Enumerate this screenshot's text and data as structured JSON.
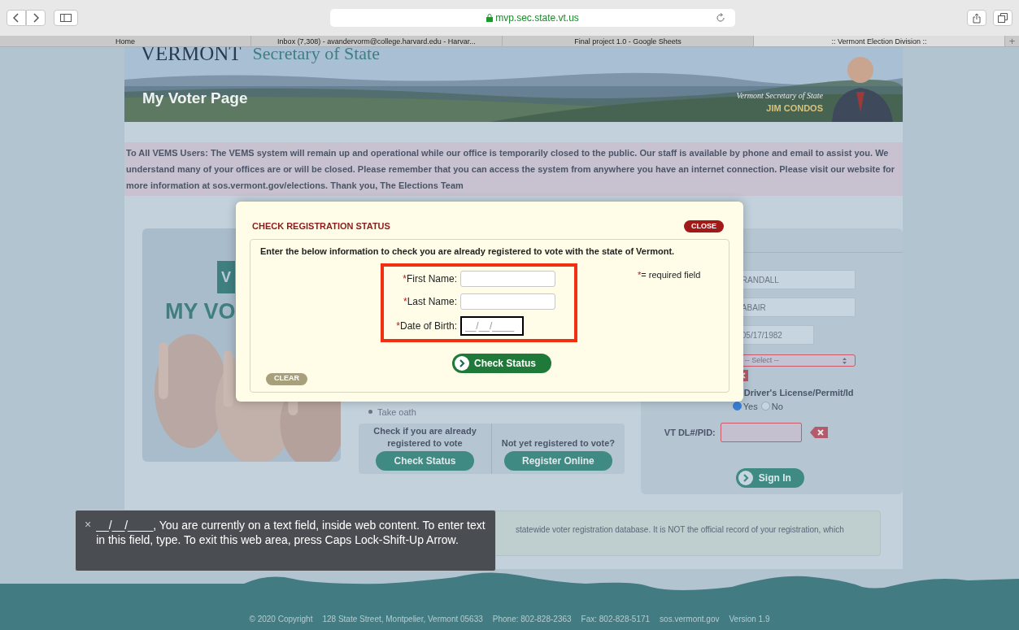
{
  "browser": {
    "url": "mvp.sec.state.vt.us",
    "tabs": [
      {
        "label": "Home",
        "selected": false
      },
      {
        "label": "Inbox (7,308) - avandervorm@college.harvard.edu - Harvar...",
        "selected": false
      },
      {
        "label": "Final project 1.0 - Google Sheets",
        "selected": false
      },
      {
        "label": ":: Vermont Election Division ::",
        "selected": true
      }
    ],
    "new_tab": "+"
  },
  "banner": {
    "state": "VERMONT",
    "office": "Secretary of State",
    "page_title": "My Voter Page",
    "official_title": "Vermont Secretary of State",
    "official_name": "JIM CONDOS"
  },
  "notice": "To All VEMS Users: The VEMS system will remain up and operational while our office is temporarily closed to the public. Our staff is available by phone and email to assist you. We understand many of your offices are or will be closed. Please remember that you can access the system from anywhere you have an internet connection. Please visit our website for more information at sos.vermont.gov/elections. Thank you, The Elections Team",
  "promo": {
    "banner_letters": "V",
    "heading": "MY VO"
  },
  "steps": {
    "last_step": "Take oath"
  },
  "actions": [
    {
      "prompt": "Check if you are already registered to vote",
      "button": "Check Status"
    },
    {
      "prompt": "Not yet registered to vote?",
      "button": "Register Online"
    }
  ],
  "sign_in": {
    "fields": [
      {
        "value": "RANDALL"
      },
      {
        "value": "ABAIR"
      },
      {
        "value": "05/17/1982"
      }
    ],
    "select": {
      "value": "-- Select --",
      "error": true
    },
    "license_question": "Driver's License/Permit/Id",
    "license_options": [
      {
        "label": "Yes",
        "selected": true
      },
      {
        "label": "No",
        "selected": false
      }
    ],
    "dl_label": "VT DL#/PID:",
    "dl_error": true,
    "button": "Sign In"
  },
  "disclaimer": "statewide voter registration database. It is NOT the official record of your registration, which",
  "modal": {
    "title": "CHECK REGISTRATION STATUS",
    "close": "CLOSE",
    "instruction": "Enter the below information to check you are already registered to vote with the state of Vermont.",
    "fields": [
      {
        "marker": "*",
        "label": "First Name:",
        "focused": false
      },
      {
        "marker": "*",
        "label": "Last Name:",
        "focused": false
      },
      {
        "marker": "*",
        "label": "Date of Birth:",
        "placeholder": "__/__/____",
        "focused": true
      }
    ],
    "required_note": {
      "marker": "*",
      "text": "= required field"
    },
    "submit": "Check Status",
    "clear": "CLEAR"
  },
  "voiceover": {
    "close": "×",
    "text": "__/__/____, You are currently on a text field, inside web content. To enter text in this field, type.  To exit this web area, press Caps Lock-Shift-Up Arrow."
  },
  "footer": [
    "© 2020 Copyright",
    "128 State Street, Montpelier, Vermont 05633",
    "Phone: 802-828-2363",
    "Fax: 802-828-5171",
    "sos.vermont.gov",
    "Version 1.9"
  ]
}
